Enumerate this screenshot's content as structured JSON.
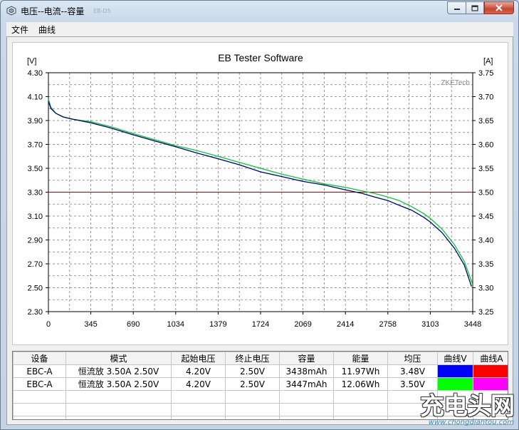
{
  "window": {
    "title": "电压--电流--容量",
    "ghost_title": "EB-D5"
  },
  "menu": [
    {
      "label": "文件"
    },
    {
      "label": "曲线"
    }
  ],
  "chart_data": {
    "type": "line",
    "title": "EB Tester Software",
    "watermark": "ZKETech",
    "ylabel_left": "[V]",
    "ylabel_right": "[A]",
    "xlim": [
      0,
      3448
    ],
    "ylim_left": [
      2.3,
      4.3
    ],
    "ylim_right": [
      3.25,
      3.75
    ],
    "x_ticks": [
      "0",
      "345",
      "690",
      "1034",
      "1379",
      "1724",
      "2069",
      "2414",
      "2758",
      "3103",
      "3448"
    ],
    "y_left_ticks": [
      "4.30",
      "4.10",
      "3.90",
      "3.70",
      "3.50",
      "3.30",
      "3.10",
      "2.90",
      "2.70",
      "2.50",
      "2.30"
    ],
    "y_right_ticks": [
      "3.75",
      "3.70",
      "3.65",
      "3.60",
      "3.55",
      "3.50",
      "3.45",
      "3.40",
      "3.35",
      "3.30",
      "3.25"
    ],
    "grid": true,
    "series": [
      {
        "color": "#000080",
        "axis": "left",
        "x": [
          0,
          20,
          60,
          120,
          200,
          345,
          500,
          690,
          860,
          1034,
          1200,
          1379,
          1550,
          1724,
          1900,
          2069,
          2240,
          2414,
          2550,
          2650,
          2758,
          2850,
          2950,
          3050,
          3103,
          3200,
          3300,
          3380,
          3438
        ],
        "y": [
          4.06,
          4.0,
          3.96,
          3.93,
          3.91,
          3.88,
          3.84,
          3.78,
          3.73,
          3.68,
          3.63,
          3.58,
          3.53,
          3.47,
          3.43,
          3.39,
          3.36,
          3.32,
          3.29,
          3.26,
          3.23,
          3.19,
          3.15,
          3.09,
          3.05,
          2.96,
          2.83,
          2.69,
          2.51
        ]
      },
      {
        "color": "#00cc33",
        "axis": "left",
        "x": [
          0,
          20,
          60,
          120,
          200,
          345,
          500,
          690,
          860,
          1034,
          1200,
          1379,
          1550,
          1724,
          1900,
          2069,
          2240,
          2414,
          2550,
          2650,
          2758,
          2850,
          2950,
          3050,
          3103,
          3200,
          3300,
          3380,
          3447
        ],
        "y": [
          4.08,
          4.01,
          3.96,
          3.93,
          3.91,
          3.89,
          3.85,
          3.79,
          3.74,
          3.69,
          3.65,
          3.6,
          3.55,
          3.5,
          3.45,
          3.41,
          3.37,
          3.34,
          3.31,
          3.29,
          3.26,
          3.23,
          3.18,
          3.12,
          3.08,
          2.99,
          2.86,
          2.72,
          2.53
        ]
      },
      {
        "color": "#c00000",
        "axis": "right",
        "x": [
          0,
          3448
        ],
        "y": [
          3.5,
          3.5
        ]
      }
    ]
  },
  "table": {
    "headers": [
      "设备",
      "模式",
      "起始电压",
      "终止电压",
      "容量",
      "能量",
      "均压",
      "曲线V",
      "曲线A"
    ],
    "rows": [
      {
        "device": "EBC-A",
        "mode": "恒流放  3.50A  2.50V",
        "v_start": "4.20V",
        "v_end": "2.50V",
        "capacity": "3438mAh",
        "energy": "11.97Wh",
        "avg_v": "3.48V",
        "curve_v_color": "#0000ff",
        "curve_a_color": "#ff0000"
      },
      {
        "device": "EBC-A",
        "mode": "恒流放  3.50A  2.50V",
        "v_start": "4.20V",
        "v_end": "2.50V",
        "capacity": "3447mAh",
        "energy": "12.06Wh",
        "avg_v": "3.50V",
        "curve_v_color": "#00ff00",
        "curve_a_color": "#ff00ff"
      }
    ]
  },
  "watermark": {
    "big": "充电头网",
    "small": "www.chongdiantou.com"
  }
}
